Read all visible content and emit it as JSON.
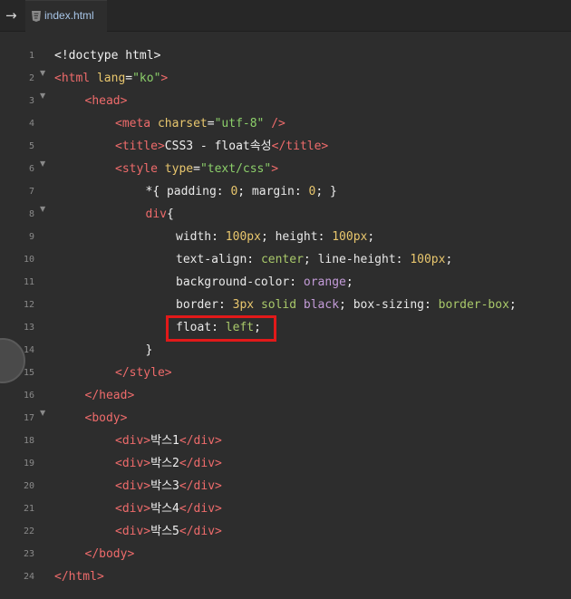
{
  "tab": {
    "title": "index.html"
  },
  "lines": [
    {
      "n": "1",
      "fold": false,
      "indent": 0,
      "segments": [
        [
          "txt",
          "<!doctype html>"
        ]
      ]
    },
    {
      "n": "2",
      "fold": true,
      "indent": 0,
      "segments": [
        [
          "tag",
          "<html "
        ],
        [
          "attr",
          "lang"
        ],
        [
          "txt",
          "="
        ],
        [
          "str",
          "\"ko\""
        ],
        [
          "tag",
          ">"
        ]
      ]
    },
    {
      "n": "3",
      "fold": true,
      "indent": 1,
      "segments": [
        [
          "tag",
          "<head>"
        ]
      ]
    },
    {
      "n": "4",
      "fold": false,
      "indent": 2,
      "segments": [
        [
          "tag",
          "<meta "
        ],
        [
          "attr",
          "charset"
        ],
        [
          "txt",
          "="
        ],
        [
          "str",
          "\"utf-8\""
        ],
        [
          "tag",
          " />"
        ]
      ]
    },
    {
      "n": "5",
      "fold": false,
      "indent": 2,
      "segments": [
        [
          "tag",
          "<title>"
        ],
        [
          "txt",
          "CSS3 - float속성"
        ],
        [
          "tag",
          "</title>"
        ]
      ]
    },
    {
      "n": "6",
      "fold": true,
      "indent": 2,
      "segments": [
        [
          "tag",
          "<style "
        ],
        [
          "attr",
          "type"
        ],
        [
          "txt",
          "="
        ],
        [
          "str",
          "\"text/css\""
        ],
        [
          "tag",
          ">"
        ]
      ]
    },
    {
      "n": "7",
      "fold": false,
      "indent": 3,
      "segments": [
        [
          "txt",
          "*{ "
        ],
        [
          "prop",
          "padding"
        ],
        [
          "txt",
          ": "
        ],
        [
          "num",
          "0"
        ],
        [
          "txt",
          "; "
        ],
        [
          "prop",
          "margin"
        ],
        [
          "txt",
          ": "
        ],
        [
          "num",
          "0"
        ],
        [
          "txt",
          "; }"
        ]
      ]
    },
    {
      "n": "8",
      "fold": true,
      "indent": 3,
      "segments": [
        [
          "tag",
          "div"
        ],
        [
          "txt",
          "{"
        ]
      ]
    },
    {
      "n": "9",
      "fold": false,
      "indent": 4,
      "segments": [
        [
          "prop",
          "width"
        ],
        [
          "txt",
          ": "
        ],
        [
          "num",
          "100px"
        ],
        [
          "txt",
          "; "
        ],
        [
          "prop",
          "height"
        ],
        [
          "txt",
          ": "
        ],
        [
          "num",
          "100px"
        ],
        [
          "txt",
          ";"
        ]
      ]
    },
    {
      "n": "10",
      "fold": false,
      "indent": 4,
      "segments": [
        [
          "prop",
          "text-align"
        ],
        [
          "txt",
          ": "
        ],
        [
          "val",
          "center"
        ],
        [
          "txt",
          "; "
        ],
        [
          "prop",
          "line-height"
        ],
        [
          "txt",
          ": "
        ],
        [
          "num",
          "100px"
        ],
        [
          "txt",
          ";"
        ]
      ]
    },
    {
      "n": "11",
      "fold": false,
      "indent": 4,
      "segments": [
        [
          "prop",
          "background-color"
        ],
        [
          "txt",
          ": "
        ],
        [
          "kw",
          "orange"
        ],
        [
          "txt",
          ";"
        ]
      ]
    },
    {
      "n": "12",
      "fold": false,
      "indent": 4,
      "segments": [
        [
          "prop",
          "border"
        ],
        [
          "txt",
          ": "
        ],
        [
          "num",
          "3px"
        ],
        [
          "txt",
          " "
        ],
        [
          "val",
          "solid"
        ],
        [
          "txt",
          " "
        ],
        [
          "kw",
          "black"
        ],
        [
          "txt",
          "; "
        ],
        [
          "prop",
          "box-sizing"
        ],
        [
          "txt",
          ": "
        ],
        [
          "val",
          "border-box"
        ],
        [
          "txt",
          ";"
        ]
      ]
    },
    {
      "n": "13",
      "fold": false,
      "indent": 4,
      "segments": [
        [
          "prop",
          "float"
        ],
        [
          "txt",
          ": "
        ],
        [
          "val",
          "left"
        ],
        [
          "txt",
          ";"
        ]
      ]
    },
    {
      "n": "14",
      "fold": false,
      "indent": 3,
      "segments": [
        [
          "txt",
          "}"
        ]
      ]
    },
    {
      "n": "15",
      "fold": false,
      "indent": 2,
      "segments": [
        [
          "tag",
          "</style>"
        ]
      ]
    },
    {
      "n": "16",
      "fold": false,
      "indent": 1,
      "segments": [
        [
          "tag",
          "</head>"
        ]
      ]
    },
    {
      "n": "17",
      "fold": true,
      "indent": 1,
      "segments": [
        [
          "tag",
          "<body>"
        ]
      ]
    },
    {
      "n": "18",
      "fold": false,
      "indent": 2,
      "segments": [
        [
          "tag",
          "<div>"
        ],
        [
          "txt",
          "박스1"
        ],
        [
          "tag",
          "</div>"
        ]
      ]
    },
    {
      "n": "19",
      "fold": false,
      "indent": 2,
      "segments": [
        [
          "tag",
          "<div>"
        ],
        [
          "txt",
          "박스2"
        ],
        [
          "tag",
          "</div>"
        ]
      ]
    },
    {
      "n": "20",
      "fold": false,
      "indent": 2,
      "segments": [
        [
          "tag",
          "<div>"
        ],
        [
          "txt",
          "박스3"
        ],
        [
          "tag",
          "</div>"
        ]
      ]
    },
    {
      "n": "21",
      "fold": false,
      "indent": 2,
      "segments": [
        [
          "tag",
          "<div>"
        ],
        [
          "txt",
          "박스4"
        ],
        [
          "tag",
          "</div>"
        ]
      ]
    },
    {
      "n": "22",
      "fold": false,
      "indent": 2,
      "segments": [
        [
          "tag",
          "<div>"
        ],
        [
          "txt",
          "박스5"
        ],
        [
          "tag",
          "</div>"
        ]
      ]
    },
    {
      "n": "23",
      "fold": false,
      "indent": 1,
      "segments": [
        [
          "tag",
          "</body>"
        ]
      ]
    },
    {
      "n": "24",
      "fold": false,
      "indent": 0,
      "segments": [
        [
          "tag",
          "</html>"
        ]
      ]
    }
  ],
  "highlight": {
    "line": "13",
    "color": "#e21919"
  },
  "colors": {
    "background": "#2d2d2d",
    "tag": "#ee6b6b",
    "attr": "#e8c66d",
    "string": "#8ccf6a",
    "keyword": "#c39bd8"
  }
}
